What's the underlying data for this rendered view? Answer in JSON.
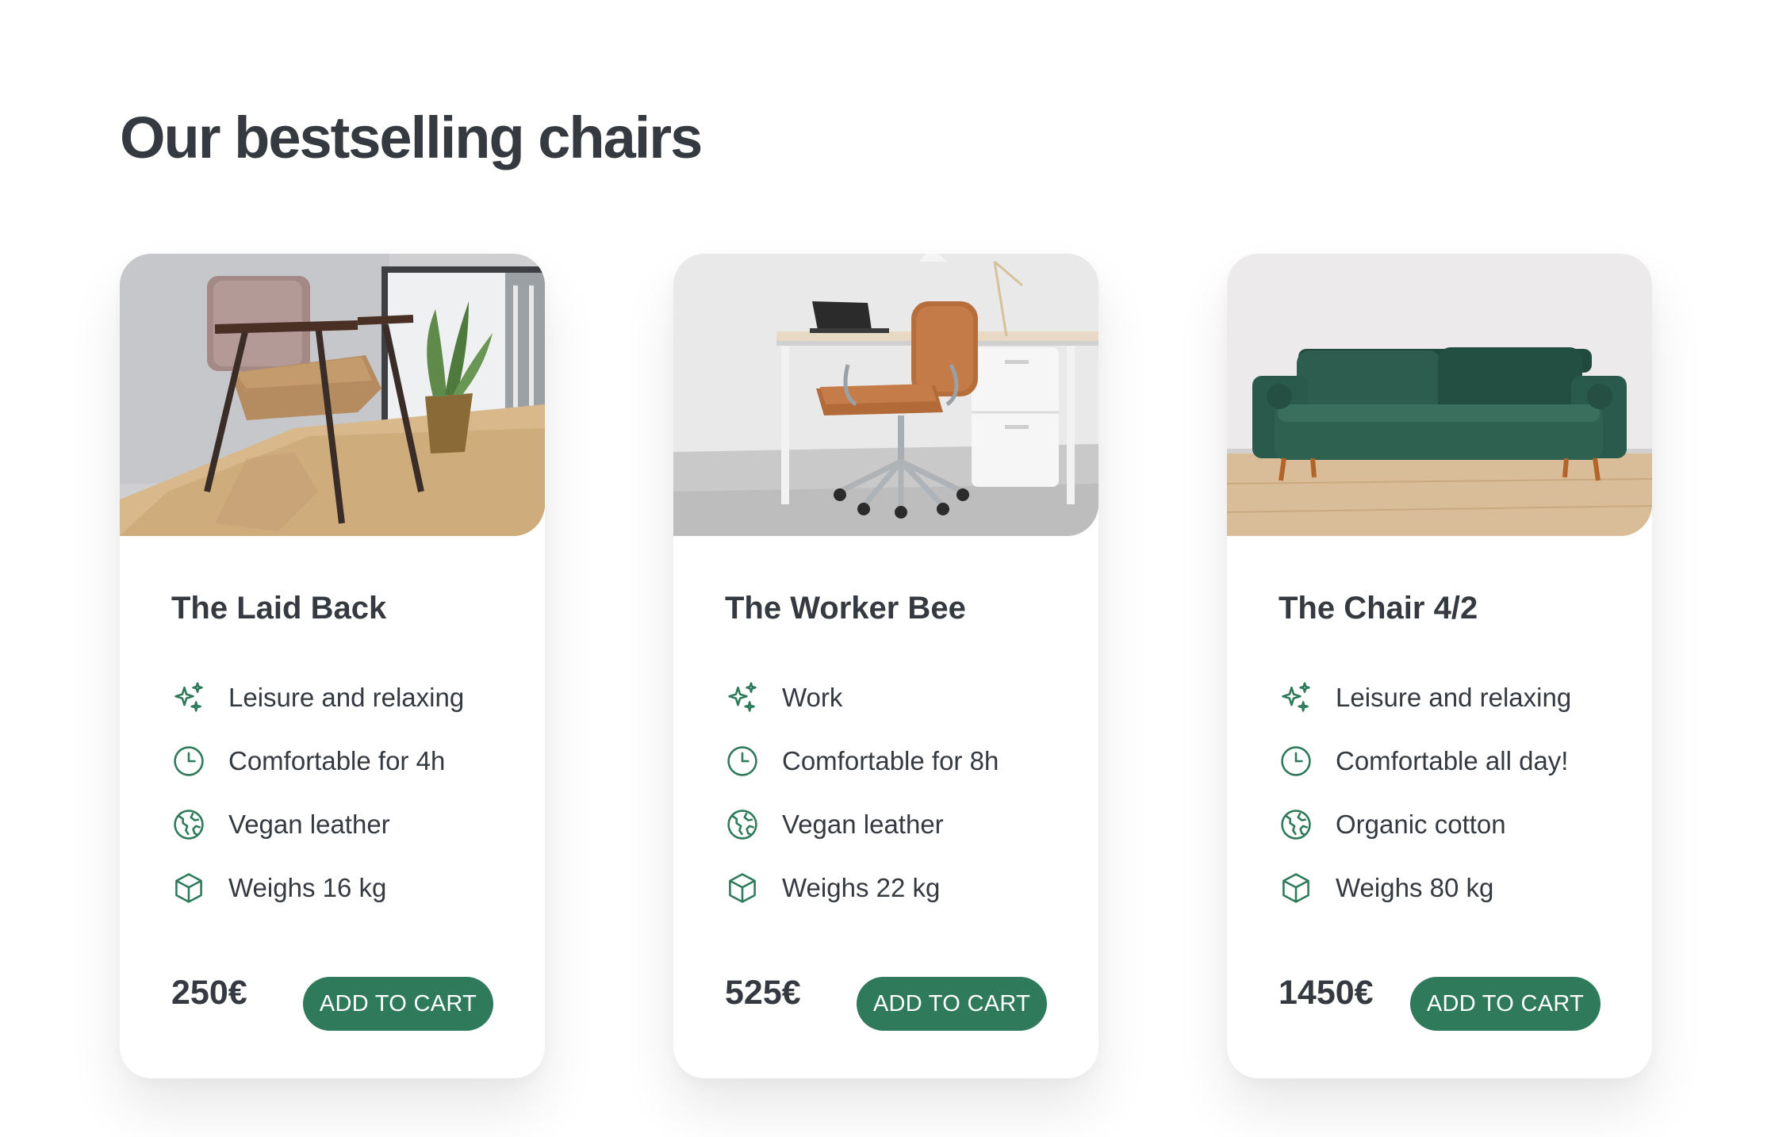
{
  "heading": "Our bestselling chairs",
  "colors": {
    "accent": "#2f7a5b",
    "text": "#343a40",
    "background": "#ffffff"
  },
  "products": [
    {
      "title": "The Laid Back",
      "image_alt": "Chair with tan leather cushions and dark metal frame",
      "attributes": [
        {
          "icon": "sparkles-icon",
          "text": "Leisure and relaxing"
        },
        {
          "icon": "clock-icon",
          "text": "Comfortable for 4h"
        },
        {
          "icon": "globe-icon",
          "text": "Vegan leather"
        },
        {
          "icon": "cube-icon",
          "text": "Weighs 16 kg"
        }
      ],
      "price": "250€",
      "button": "ADD TO CART"
    },
    {
      "title": "The Worker Bee",
      "image_alt": "Brown leather office chair at a white desk",
      "attributes": [
        {
          "icon": "sparkles-icon",
          "text": "Work"
        },
        {
          "icon": "clock-icon",
          "text": "Comfortable for 8h"
        },
        {
          "icon": "globe-icon",
          "text": "Vegan leather"
        },
        {
          "icon": "cube-icon",
          "text": "Weighs 22 kg"
        }
      ],
      "price": "525€",
      "button": "ADD TO CART"
    },
    {
      "title": "The Chair 4/2",
      "image_alt": "Dark green velvet sofa on wooden floor",
      "attributes": [
        {
          "icon": "sparkles-icon",
          "text": "Leisure and relaxing"
        },
        {
          "icon": "clock-icon",
          "text": "Comfortable all day!"
        },
        {
          "icon": "globe-icon",
          "text": "Organic cotton"
        },
        {
          "icon": "cube-icon",
          "text": "Weighs 80 kg"
        }
      ],
      "price": "1450€",
      "button": "ADD TO CART"
    }
  ]
}
